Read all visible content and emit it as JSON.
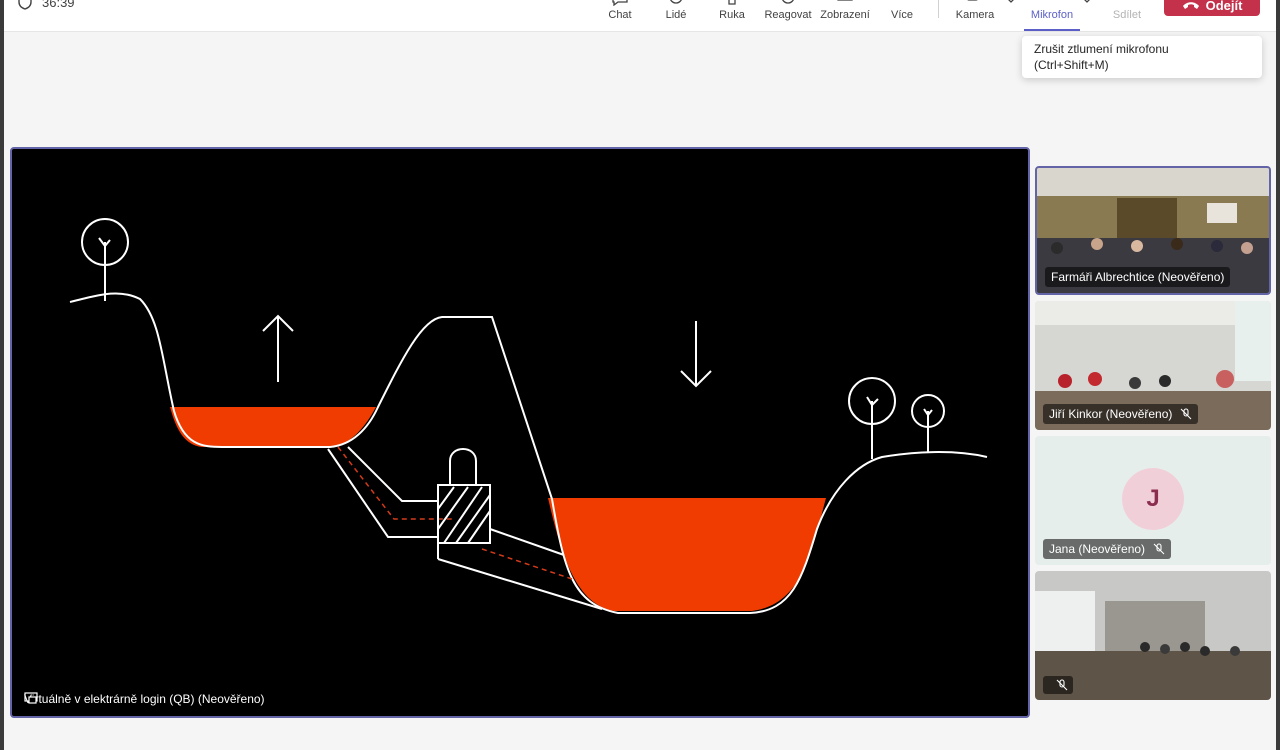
{
  "topbar": {
    "timer": "36:39",
    "buttons": {
      "chat": "Chat",
      "people": "Lidé",
      "raise": "Ruka",
      "react": "Reagovat",
      "view": "Zobrazení",
      "more": "Více",
      "camera": "Kamera",
      "mic": "Mikrofon",
      "share": "Sdílet",
      "leave": "Odejít"
    }
  },
  "tooltip": {
    "line1": "Zrušit ztlumení mikrofonu",
    "line2": "(Ctrl+Shift+M)"
  },
  "stage": {
    "presenter": "Virtuálně v elektrárně login (QB) (Neověřeno)"
  },
  "tiles": [
    {
      "label": "Farmáři Albrechtice (Neověřeno)"
    },
    {
      "label": "Jiří Kinkor (Neověřeno)"
    },
    {
      "label": "Jana (Neověřeno)",
      "initial": "J"
    },
    {
      "label": ""
    }
  ],
  "colors": {
    "accent": "#6264a7",
    "leave": "#c4314b",
    "water": "#f03c00"
  }
}
